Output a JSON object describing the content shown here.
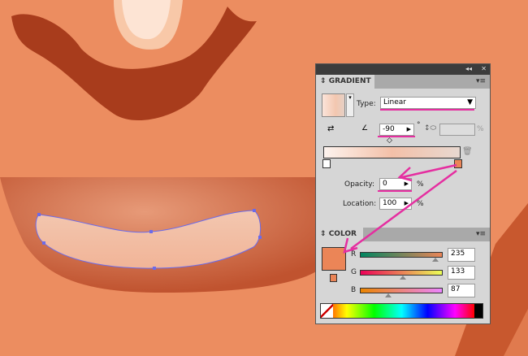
{
  "gradient": {
    "tab": "GRADIENT",
    "type_label": "Type:",
    "type_value": "Linear",
    "angle": "-90",
    "degree": "°",
    "percent": "%",
    "opacity_label": "Opacity:",
    "opacity_value": "0",
    "location_label": "Location:",
    "location_value": "100"
  },
  "color": {
    "tab": "COLOR",
    "r_label": "R",
    "g_label": "G",
    "b_label": "B",
    "r": "235",
    "g": "133",
    "b": "87",
    "swatch": "#eb8557"
  },
  "topbar": {
    "collapse": "◂◂",
    "close": "✕"
  },
  "colors": {
    "skin": "#ec8d60",
    "mustache": "#a83c1c",
    "annotation": "#e52ea0"
  }
}
